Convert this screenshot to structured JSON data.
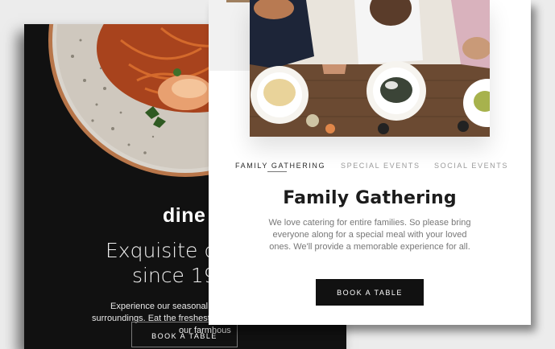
{
  "back_card": {
    "brand": "dine",
    "headline_line1": "Exquisite d",
    "headline_line2": "since 19",
    "description_line1": "Experience our seasonal menu",
    "description_line2": "surroundings. Eat the freshest prod",
    "description_line3": "our farmhous",
    "button_label": "BOOK A TABLE"
  },
  "front_card": {
    "tabs": [
      {
        "label": "FAMILY GATHERING",
        "active": true
      },
      {
        "label": "SPECIAL EVENTS",
        "active": false
      },
      {
        "label": "SOCIAL EVENTS",
        "active": false
      }
    ],
    "title": "Family Gathering",
    "description": "We love catering for entire families. So please bring everyone along for a special meal with your loved ones. We'll provide a memorable experience for all.",
    "button_label": "BOOK A TABLE"
  },
  "colors": {
    "page_background": "#ececec",
    "dark_card": "#111111",
    "button_dark": "#111111",
    "text_dark": "#1c1c1c",
    "text_muted": "#777777"
  }
}
